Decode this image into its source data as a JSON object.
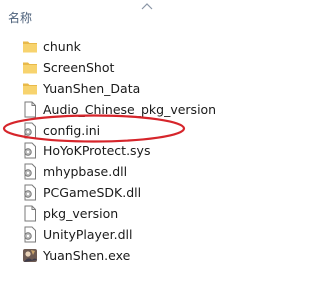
{
  "header": {
    "name_column": "名称"
  },
  "annotation": {
    "highlight_color": "#d6252b",
    "highlighted_item": "config.ini"
  },
  "files": [
    {
      "name": "chunk",
      "icon": "folder-icon"
    },
    {
      "name": "ScreenShot",
      "icon": "folder-icon"
    },
    {
      "name": "YuanShen_Data",
      "icon": "folder-icon"
    },
    {
      "name": "Audio_Chinese_pkg_version",
      "icon": "file-icon"
    },
    {
      "name": "config.ini",
      "icon": "settings-file-icon"
    },
    {
      "name": "HoYoKProtect.sys",
      "icon": "settings-file-icon"
    },
    {
      "name": "mhypbase.dll",
      "icon": "settings-file-icon"
    },
    {
      "name": "PCGameSDK.dll",
      "icon": "settings-file-icon"
    },
    {
      "name": "pkg_version",
      "icon": "file-icon"
    },
    {
      "name": "UnityPlayer.dll",
      "icon": "settings-file-icon"
    },
    {
      "name": "YuanShen.exe",
      "icon": "exe-icon"
    }
  ]
}
